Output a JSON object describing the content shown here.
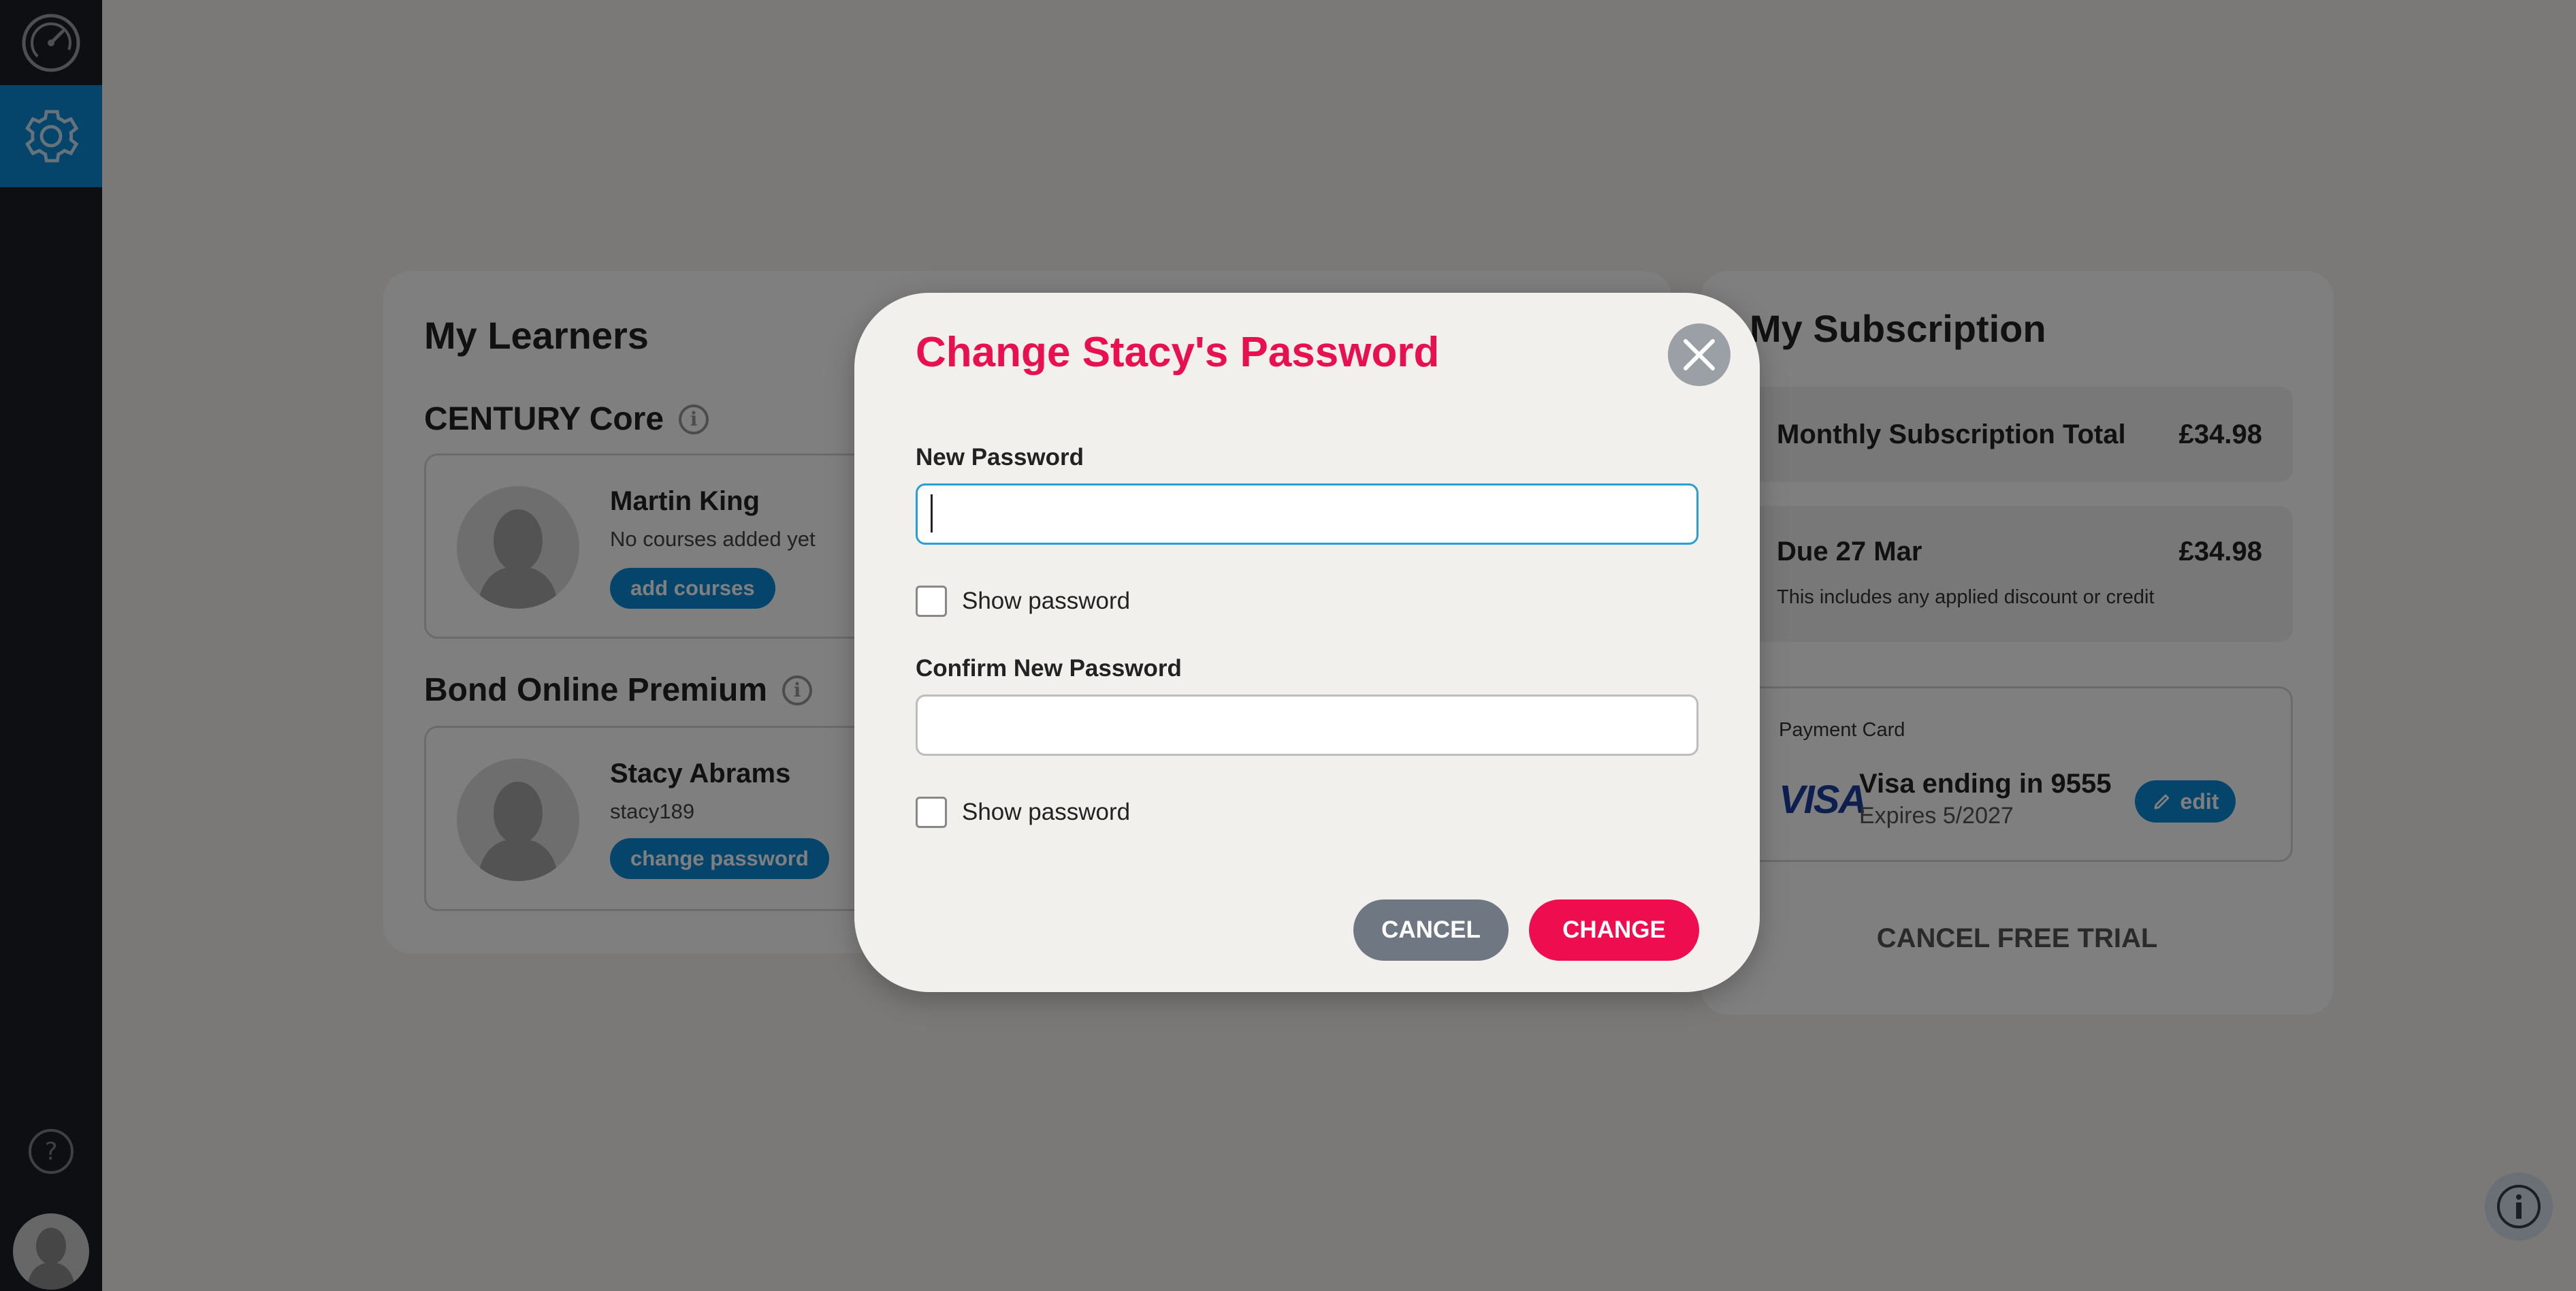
{
  "colors": {
    "sidebar_bg": "#1b1f25",
    "accent_blue": "#0a8bd6",
    "accent_pink": "#ee0d4e",
    "modal_bg": "#f1f0ed",
    "cancel_gray": "#6f7882"
  },
  "sidebar": {
    "items": [
      {
        "icon": "speedometer-icon",
        "active": false
      },
      {
        "icon": "gear-icon",
        "active": true
      },
      {
        "icon": "help-icon",
        "active": false
      },
      {
        "icon": "avatar-icon",
        "active": false
      }
    ]
  },
  "learners": {
    "title": "My Learners",
    "sections": [
      {
        "title": "CENTURY Core",
        "learner": {
          "name": "Martin King",
          "sub": "No courses added yet",
          "action": "add courses"
        }
      },
      {
        "title": "Bond Online Premium",
        "learner": {
          "name": "Stacy Abrams",
          "sub": "stacy189",
          "action": "change password"
        }
      }
    ]
  },
  "subscription": {
    "title": "My Subscription",
    "monthly_label": "Monthly Subscription Total",
    "monthly_value": "£34.98",
    "due_label": "Due 27 Mar",
    "due_value": "£34.98",
    "due_note": "This includes any applied discount or credit",
    "payment_label": "Payment Card",
    "card_brand": "VISA",
    "card_text": "Visa ending in 9555",
    "card_expiry": "Expires 5/2027",
    "edit_label": "edit",
    "cancel_trial_label": "CANCEL FREE TRIAL"
  },
  "modal": {
    "title": "Change Stacy's Password",
    "new_password_label": "New Password",
    "new_password_value": "",
    "confirm_label": "Confirm New Password",
    "confirm_value": "",
    "show_password_label": "Show password",
    "cancel_label": "CANCEL",
    "change_label": "CHANGE"
  }
}
